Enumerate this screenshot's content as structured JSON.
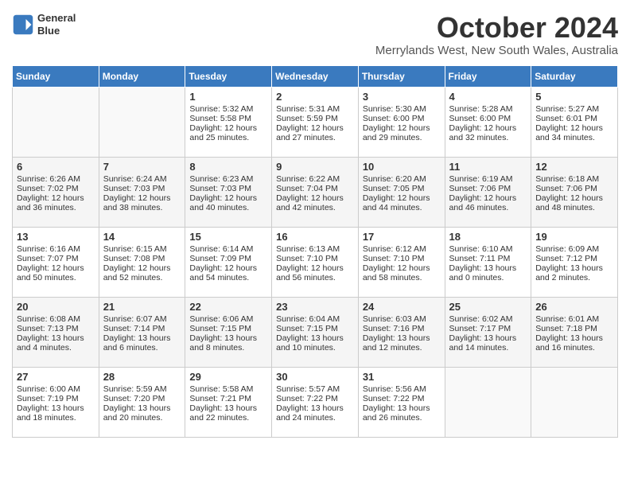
{
  "header": {
    "logo_line1": "General",
    "logo_line2": "Blue",
    "month": "October 2024",
    "location": "Merrylands West, New South Wales, Australia"
  },
  "weekdays": [
    "Sunday",
    "Monday",
    "Tuesday",
    "Wednesday",
    "Thursday",
    "Friday",
    "Saturday"
  ],
  "weeks": [
    [
      {
        "day": "",
        "sunrise": "",
        "sunset": "",
        "daylight": ""
      },
      {
        "day": "",
        "sunrise": "",
        "sunset": "",
        "daylight": ""
      },
      {
        "day": "1",
        "sunrise": "Sunrise: 5:32 AM",
        "sunset": "Sunset: 5:58 PM",
        "daylight": "Daylight: 12 hours and 25 minutes."
      },
      {
        "day": "2",
        "sunrise": "Sunrise: 5:31 AM",
        "sunset": "Sunset: 5:59 PM",
        "daylight": "Daylight: 12 hours and 27 minutes."
      },
      {
        "day": "3",
        "sunrise": "Sunrise: 5:30 AM",
        "sunset": "Sunset: 6:00 PM",
        "daylight": "Daylight: 12 hours and 29 minutes."
      },
      {
        "day": "4",
        "sunrise": "Sunrise: 5:28 AM",
        "sunset": "Sunset: 6:00 PM",
        "daylight": "Daylight: 12 hours and 32 minutes."
      },
      {
        "day": "5",
        "sunrise": "Sunrise: 5:27 AM",
        "sunset": "Sunset: 6:01 PM",
        "daylight": "Daylight: 12 hours and 34 minutes."
      }
    ],
    [
      {
        "day": "6",
        "sunrise": "Sunrise: 6:26 AM",
        "sunset": "Sunset: 7:02 PM",
        "daylight": "Daylight: 12 hours and 36 minutes."
      },
      {
        "day": "7",
        "sunrise": "Sunrise: 6:24 AM",
        "sunset": "Sunset: 7:03 PM",
        "daylight": "Daylight: 12 hours and 38 minutes."
      },
      {
        "day": "8",
        "sunrise": "Sunrise: 6:23 AM",
        "sunset": "Sunset: 7:03 PM",
        "daylight": "Daylight: 12 hours and 40 minutes."
      },
      {
        "day": "9",
        "sunrise": "Sunrise: 6:22 AM",
        "sunset": "Sunset: 7:04 PM",
        "daylight": "Daylight: 12 hours and 42 minutes."
      },
      {
        "day": "10",
        "sunrise": "Sunrise: 6:20 AM",
        "sunset": "Sunset: 7:05 PM",
        "daylight": "Daylight: 12 hours and 44 minutes."
      },
      {
        "day": "11",
        "sunrise": "Sunrise: 6:19 AM",
        "sunset": "Sunset: 7:06 PM",
        "daylight": "Daylight: 12 hours and 46 minutes."
      },
      {
        "day": "12",
        "sunrise": "Sunrise: 6:18 AM",
        "sunset": "Sunset: 7:06 PM",
        "daylight": "Daylight: 12 hours and 48 minutes."
      }
    ],
    [
      {
        "day": "13",
        "sunrise": "Sunrise: 6:16 AM",
        "sunset": "Sunset: 7:07 PM",
        "daylight": "Daylight: 12 hours and 50 minutes."
      },
      {
        "day": "14",
        "sunrise": "Sunrise: 6:15 AM",
        "sunset": "Sunset: 7:08 PM",
        "daylight": "Daylight: 12 hours and 52 minutes."
      },
      {
        "day": "15",
        "sunrise": "Sunrise: 6:14 AM",
        "sunset": "Sunset: 7:09 PM",
        "daylight": "Daylight: 12 hours and 54 minutes."
      },
      {
        "day": "16",
        "sunrise": "Sunrise: 6:13 AM",
        "sunset": "Sunset: 7:10 PM",
        "daylight": "Daylight: 12 hours and 56 minutes."
      },
      {
        "day": "17",
        "sunrise": "Sunrise: 6:12 AM",
        "sunset": "Sunset: 7:10 PM",
        "daylight": "Daylight: 12 hours and 58 minutes."
      },
      {
        "day": "18",
        "sunrise": "Sunrise: 6:10 AM",
        "sunset": "Sunset: 7:11 PM",
        "daylight": "Daylight: 13 hours and 0 minutes."
      },
      {
        "day": "19",
        "sunrise": "Sunrise: 6:09 AM",
        "sunset": "Sunset: 7:12 PM",
        "daylight": "Daylight: 13 hours and 2 minutes."
      }
    ],
    [
      {
        "day": "20",
        "sunrise": "Sunrise: 6:08 AM",
        "sunset": "Sunset: 7:13 PM",
        "daylight": "Daylight: 13 hours and 4 minutes."
      },
      {
        "day": "21",
        "sunrise": "Sunrise: 6:07 AM",
        "sunset": "Sunset: 7:14 PM",
        "daylight": "Daylight: 13 hours and 6 minutes."
      },
      {
        "day": "22",
        "sunrise": "Sunrise: 6:06 AM",
        "sunset": "Sunset: 7:15 PM",
        "daylight": "Daylight: 13 hours and 8 minutes."
      },
      {
        "day": "23",
        "sunrise": "Sunrise: 6:04 AM",
        "sunset": "Sunset: 7:15 PM",
        "daylight": "Daylight: 13 hours and 10 minutes."
      },
      {
        "day": "24",
        "sunrise": "Sunrise: 6:03 AM",
        "sunset": "Sunset: 7:16 PM",
        "daylight": "Daylight: 13 hours and 12 minutes."
      },
      {
        "day": "25",
        "sunrise": "Sunrise: 6:02 AM",
        "sunset": "Sunset: 7:17 PM",
        "daylight": "Daylight: 13 hours and 14 minutes."
      },
      {
        "day": "26",
        "sunrise": "Sunrise: 6:01 AM",
        "sunset": "Sunset: 7:18 PM",
        "daylight": "Daylight: 13 hours and 16 minutes."
      }
    ],
    [
      {
        "day": "27",
        "sunrise": "Sunrise: 6:00 AM",
        "sunset": "Sunset: 7:19 PM",
        "daylight": "Daylight: 13 hours and 18 minutes."
      },
      {
        "day": "28",
        "sunrise": "Sunrise: 5:59 AM",
        "sunset": "Sunset: 7:20 PM",
        "daylight": "Daylight: 13 hours and 20 minutes."
      },
      {
        "day": "29",
        "sunrise": "Sunrise: 5:58 AM",
        "sunset": "Sunset: 7:21 PM",
        "daylight": "Daylight: 13 hours and 22 minutes."
      },
      {
        "day": "30",
        "sunrise": "Sunrise: 5:57 AM",
        "sunset": "Sunset: 7:22 PM",
        "daylight": "Daylight: 13 hours and 24 minutes."
      },
      {
        "day": "31",
        "sunrise": "Sunrise: 5:56 AM",
        "sunset": "Sunset: 7:22 PM",
        "daylight": "Daylight: 13 hours and 26 minutes."
      },
      {
        "day": "",
        "sunrise": "",
        "sunset": "",
        "daylight": ""
      },
      {
        "day": "",
        "sunrise": "",
        "sunset": "",
        "daylight": ""
      }
    ]
  ]
}
